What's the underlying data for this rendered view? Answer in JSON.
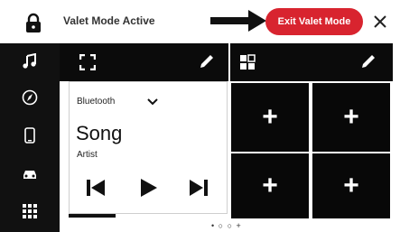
{
  "header": {
    "title": "Valet Mode Active",
    "exit_label": "Exit Valet Mode",
    "accent": "#d8242f"
  },
  "sidebar": {
    "items": [
      {
        "icon": "music-note-icon"
      },
      {
        "icon": "navigation-icon"
      },
      {
        "icon": "phone-icon"
      },
      {
        "icon": "car-icon"
      },
      {
        "icon": "apps-grid-icon"
      }
    ]
  },
  "media": {
    "source": "Bluetooth",
    "song": "Song",
    "artist": "Artist",
    "progress": 0.3
  },
  "pager": {
    "dots": "• ○ ○ +"
  },
  "tiles": [
    {
      "label": "+"
    },
    {
      "label": "+"
    },
    {
      "label": "+"
    },
    {
      "label": "+"
    }
  ]
}
